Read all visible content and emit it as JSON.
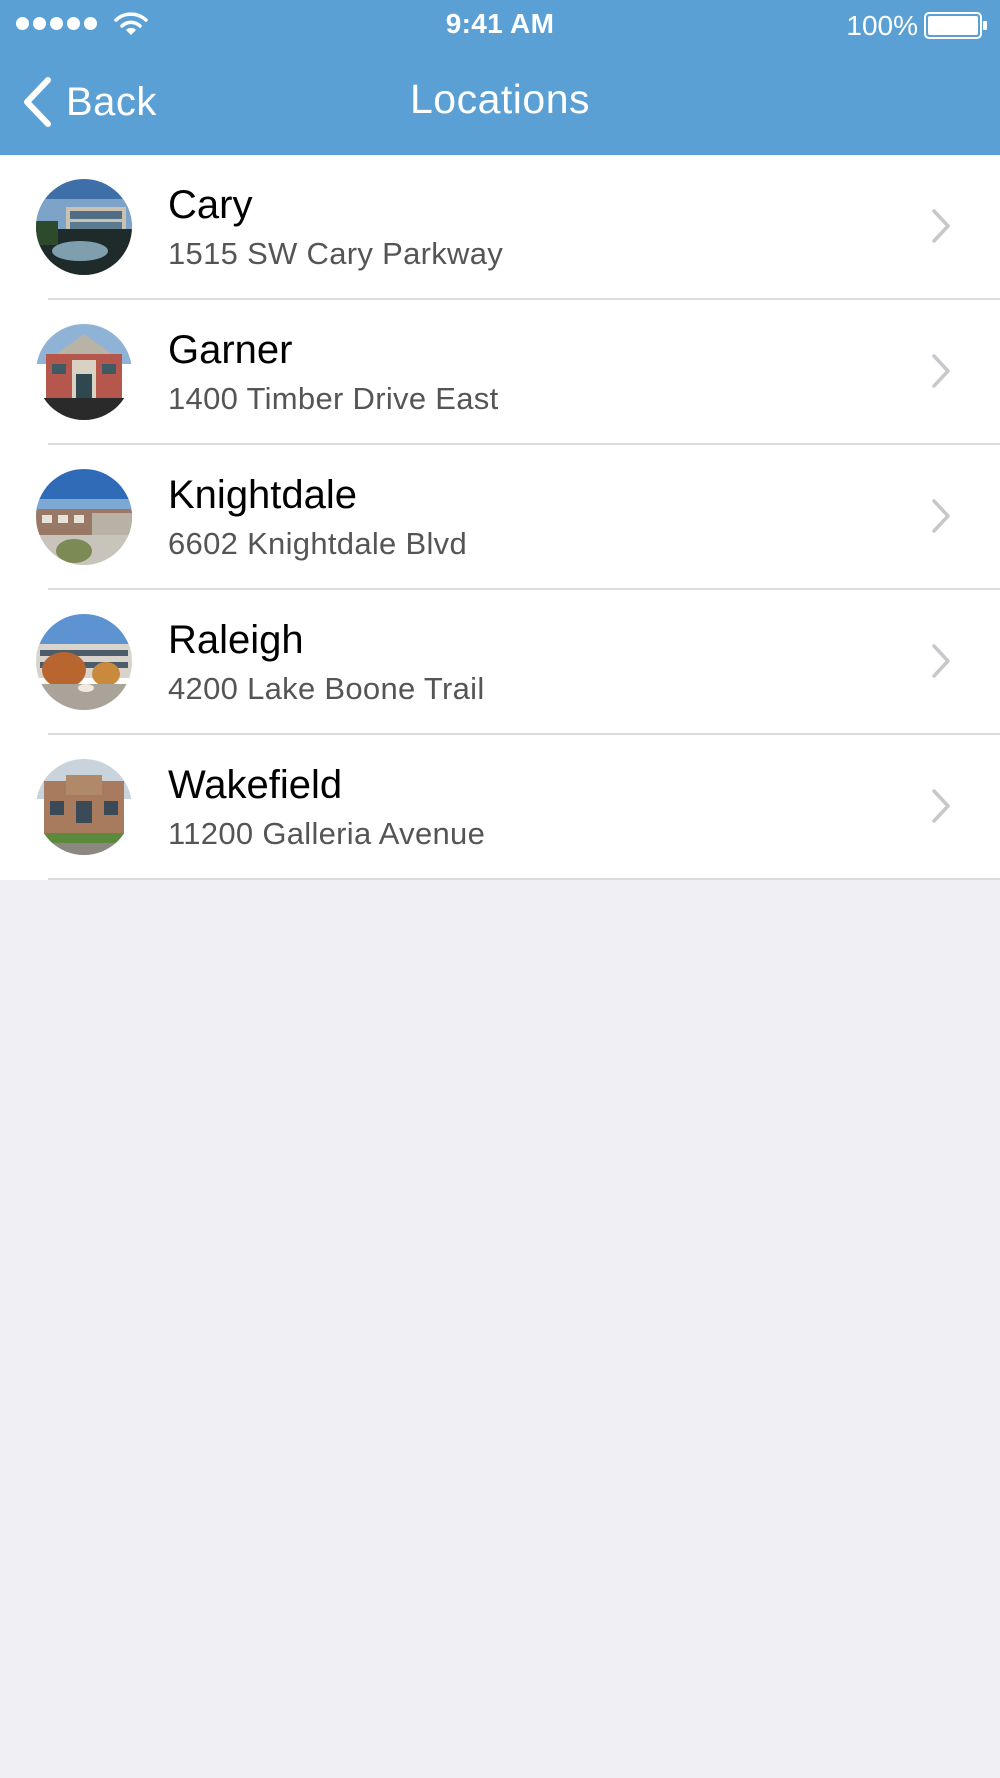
{
  "status_bar": {
    "time": "9:41 AM",
    "battery_percent": "100%",
    "signal_icon": "signal-dots-icon",
    "wifi_icon": "wifi-icon",
    "battery_icon": "battery-full-icon"
  },
  "nav": {
    "back_label": "Back",
    "back_icon": "chevron-left-icon",
    "title": "Locations"
  },
  "colors": {
    "header_blue": "#5aa0d4",
    "background": "#efeff4",
    "separator": "#dcdcdf",
    "chevron": "#c7c7cc",
    "address_gray": "#555555"
  },
  "locations": [
    {
      "name": "Cary",
      "address": "1515 SW Cary Parkway"
    },
    {
      "name": "Garner",
      "address": "1400 Timber Drive East"
    },
    {
      "name": "Knightdale",
      "address": "6602 Knightdale Blvd"
    },
    {
      "name": "Raleigh",
      "address": "4200 Lake Boone Trail"
    },
    {
      "name": "Wakefield",
      "address": "11200 Galleria Avenue"
    }
  ]
}
